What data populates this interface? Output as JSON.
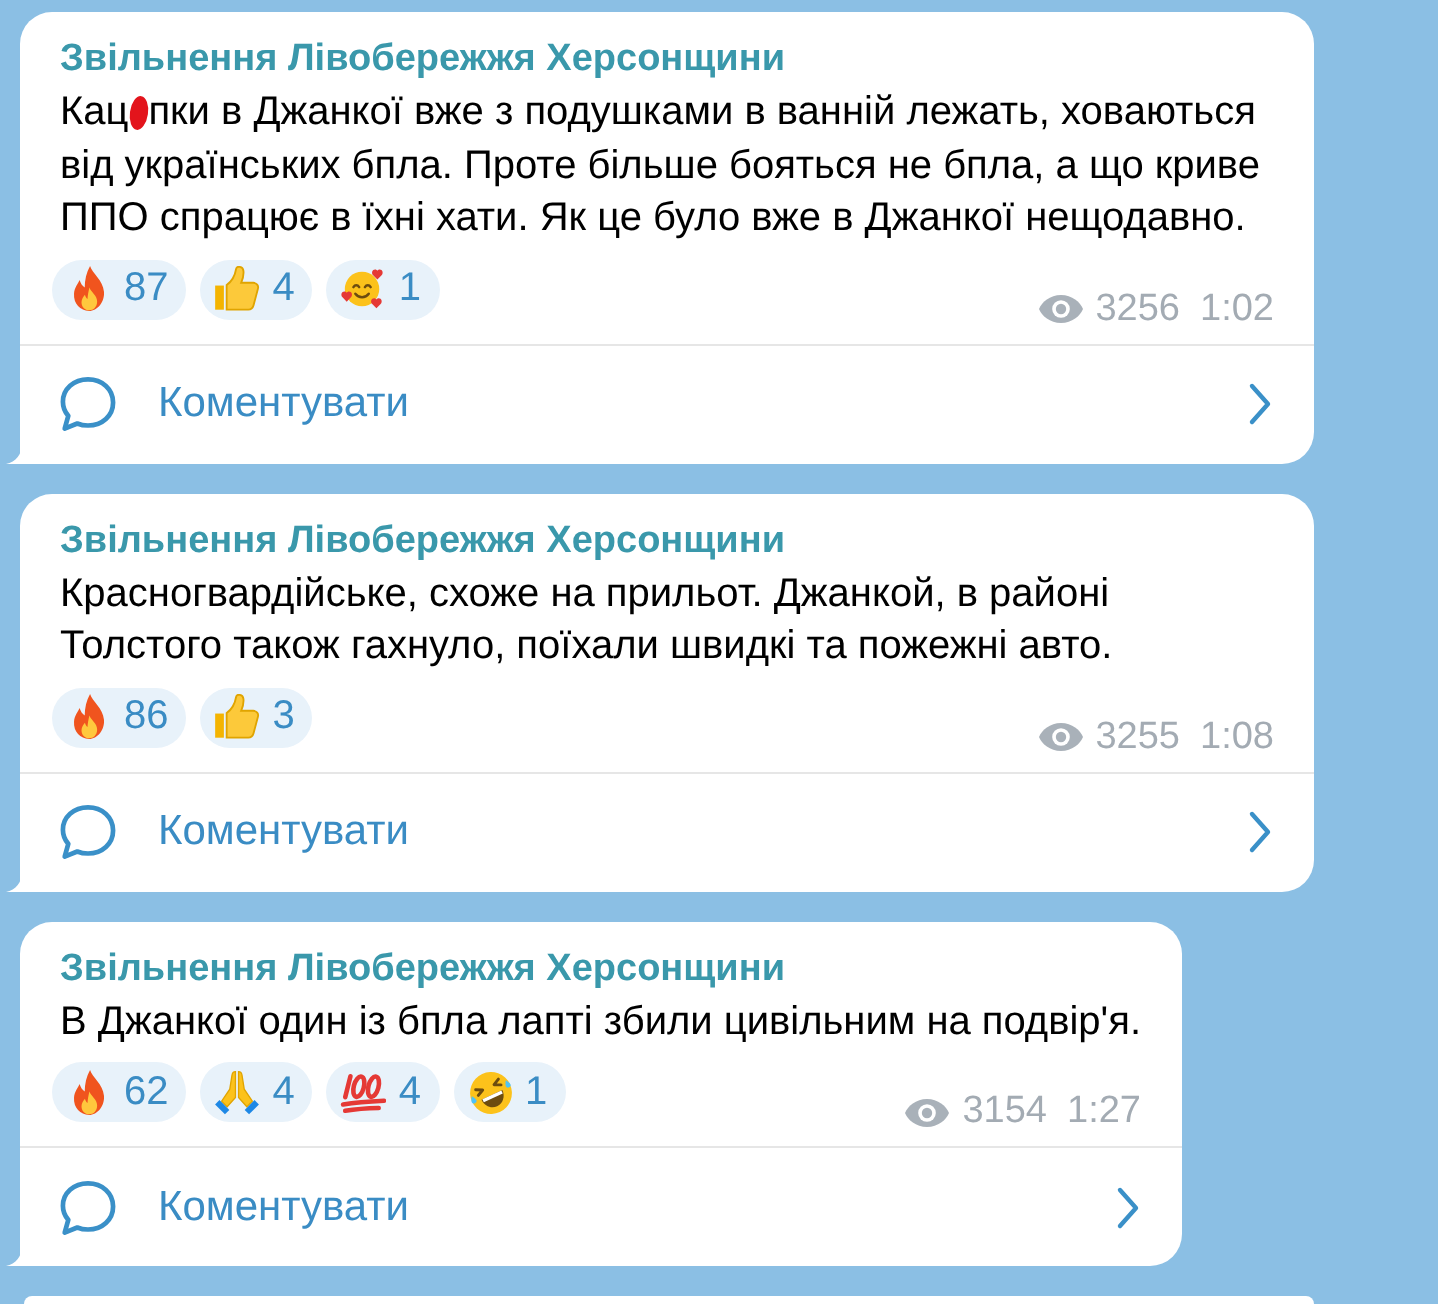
{
  "messages": [
    {
      "channel": "Звільнення Лівобережжя Херсонщини",
      "text": "Кац пки в Джанкої вже з подушками в ванній лежать, ховаються від українських бпла. Проте більше бояться не бпла, а що криве ППО спрацює в їхні хати. Як це було вже в Джанкої нещодавно.",
      "scribble": true,
      "reactions": [
        {
          "kind": "fire",
          "count": "87",
          "selected": false
        },
        {
          "kind": "thumbs_up",
          "count": "4",
          "selected": false
        },
        {
          "kind": "smiling_hearts",
          "count": "1",
          "selected": false
        }
      ],
      "views": "3256",
      "time": "1:02",
      "comment_label": "Коментувати"
    },
    {
      "channel": "Звільнення Лівобережжя Херсонщини",
      "text": "Красногвардійське, схоже на прильот. Джанкой, в районі Толстого також гахнуло, поїхали швидкі та пожежні авто.",
      "reactions": [
        {
          "kind": "fire",
          "count": "86",
          "selected": false
        },
        {
          "kind": "thumbs_up",
          "count": "3",
          "selected": false
        }
      ],
      "views": "3255",
      "time": "1:08",
      "comment_label": "Коментувати"
    },
    {
      "channel": "Звільнення Лівобережжя Херсонщини",
      "text": "В Джанкої один із бпла лапті збили цивільним на подвір'я.",
      "reactions": [
        {
          "kind": "fire",
          "count": "62",
          "selected": false
        },
        {
          "kind": "folded_hands",
          "count": "4",
          "selected": false
        },
        {
          "kind": "hundred",
          "count": "4",
          "selected": false
        },
        {
          "kind": "rofl",
          "count": "1",
          "selected": false
        }
      ],
      "views": "3154",
      "time": "1:27",
      "comment_label": "Коментувати"
    }
  ],
  "more_below": true
}
